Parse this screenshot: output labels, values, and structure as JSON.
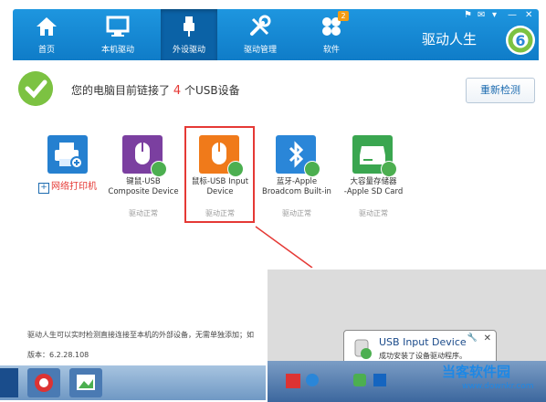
{
  "window": {
    "brand": "驱动人生",
    "controls": [
      "⚑",
      "✉",
      "▾",
      "—",
      "✕"
    ]
  },
  "nav": {
    "tabs": [
      {
        "label": "首页"
      },
      {
        "label": "本机驱动"
      },
      {
        "label": "外设驱动"
      },
      {
        "label": "驱动管理"
      },
      {
        "label": "软件",
        "badge": "2"
      }
    ],
    "active_index": 2
  },
  "banner": {
    "prefix": "您的电脑目前链接了",
    "count": "4",
    "suffix": "个USB设备",
    "rescan_label": "重新检测"
  },
  "printer": {
    "label": "网络打印机"
  },
  "devices": [
    {
      "name_line1": "键鼠-USB",
      "name_line2": "Composite Device",
      "status": "驱动正常",
      "color": "#7b3fa0"
    },
    {
      "name_line1": "鼠标-USB Input",
      "name_line2": "Device",
      "status": "驱动正常",
      "color": "#f07a1a"
    },
    {
      "name_line1": "蓝牙-Apple",
      "name_line2": "Broadcom Built-in",
      "status": "驱动正常",
      "color": "#2a86d8"
    },
    {
      "name_line1": "大容量存储器",
      "name_line2": "-Apple SD Card",
      "status": "驱动正常",
      "color": "#3aa650"
    }
  ],
  "footer": {
    "text": "驱动人生可以实时检测直接连接至本机的外部设备，无需单独添加；如",
    "version": "版本：6.2.28.108"
  },
  "balloon": {
    "title": "USB Input Device",
    "message": "成功安装了设备驱动程序。",
    "close": "✕"
  },
  "watermark": {
    "line1": "当客软件园",
    "line2": "www.downkr.com"
  }
}
